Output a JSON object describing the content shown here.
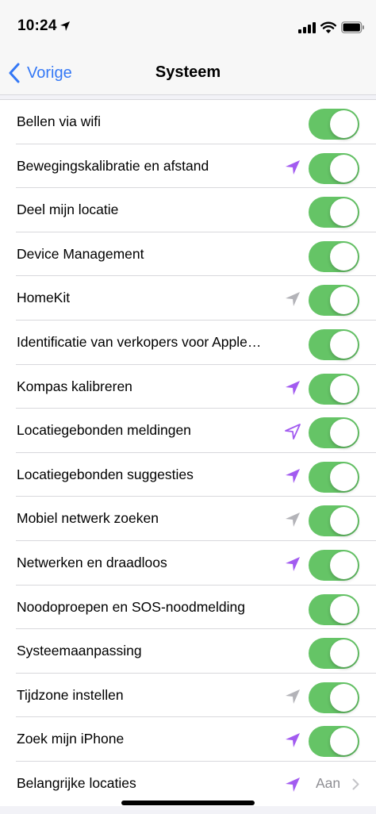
{
  "status_bar": {
    "time": "10:24"
  },
  "nav": {
    "back_label": "Vorige",
    "title": "Systeem"
  },
  "colors": {
    "toggle_on": "#65c466",
    "arrow_purple": "#a25bf0",
    "arrow_gray": "#b3b3b8",
    "link_blue": "#3478f6"
  },
  "rows": [
    {
      "label": "Bellen via wifi",
      "arrow": "none",
      "toggle_on": true
    },
    {
      "label": "Bewegingskalibratie en afstand",
      "arrow": "purple-filled",
      "toggle_on": true
    },
    {
      "label": "Deel mijn locatie",
      "arrow": "none",
      "toggle_on": true
    },
    {
      "label": "Device Management",
      "arrow": "none",
      "toggle_on": true
    },
    {
      "label": "HomeKit",
      "arrow": "gray-filled",
      "toggle_on": true
    },
    {
      "label": "Identificatie van verkopers voor Apple…",
      "arrow": "none",
      "toggle_on": true
    },
    {
      "label": "Kompas kalibreren",
      "arrow": "purple-filled",
      "toggle_on": true
    },
    {
      "label": "Locatiegebonden meldingen",
      "arrow": "purple-outline",
      "toggle_on": true
    },
    {
      "label": "Locatiegebonden suggesties",
      "arrow": "purple-filled",
      "toggle_on": true
    },
    {
      "label": "Mobiel netwerk zoeken",
      "arrow": "gray-filled",
      "toggle_on": true
    },
    {
      "label": "Netwerken en draadloos",
      "arrow": "purple-filled",
      "toggle_on": true
    },
    {
      "label": "Noodoproepen en SOS-noodmelding",
      "arrow": "none",
      "toggle_on": true
    },
    {
      "label": "Systeemaanpassing",
      "arrow": "none",
      "toggle_on": true
    },
    {
      "label": "Tijdzone instellen",
      "arrow": "gray-filled",
      "toggle_on": true
    },
    {
      "label": "Zoek mijn iPhone",
      "arrow": "purple-filled",
      "toggle_on": true
    }
  ],
  "last_row": {
    "label": "Belangrijke locaties",
    "arrow": "purple-filled",
    "value": "Aan"
  }
}
